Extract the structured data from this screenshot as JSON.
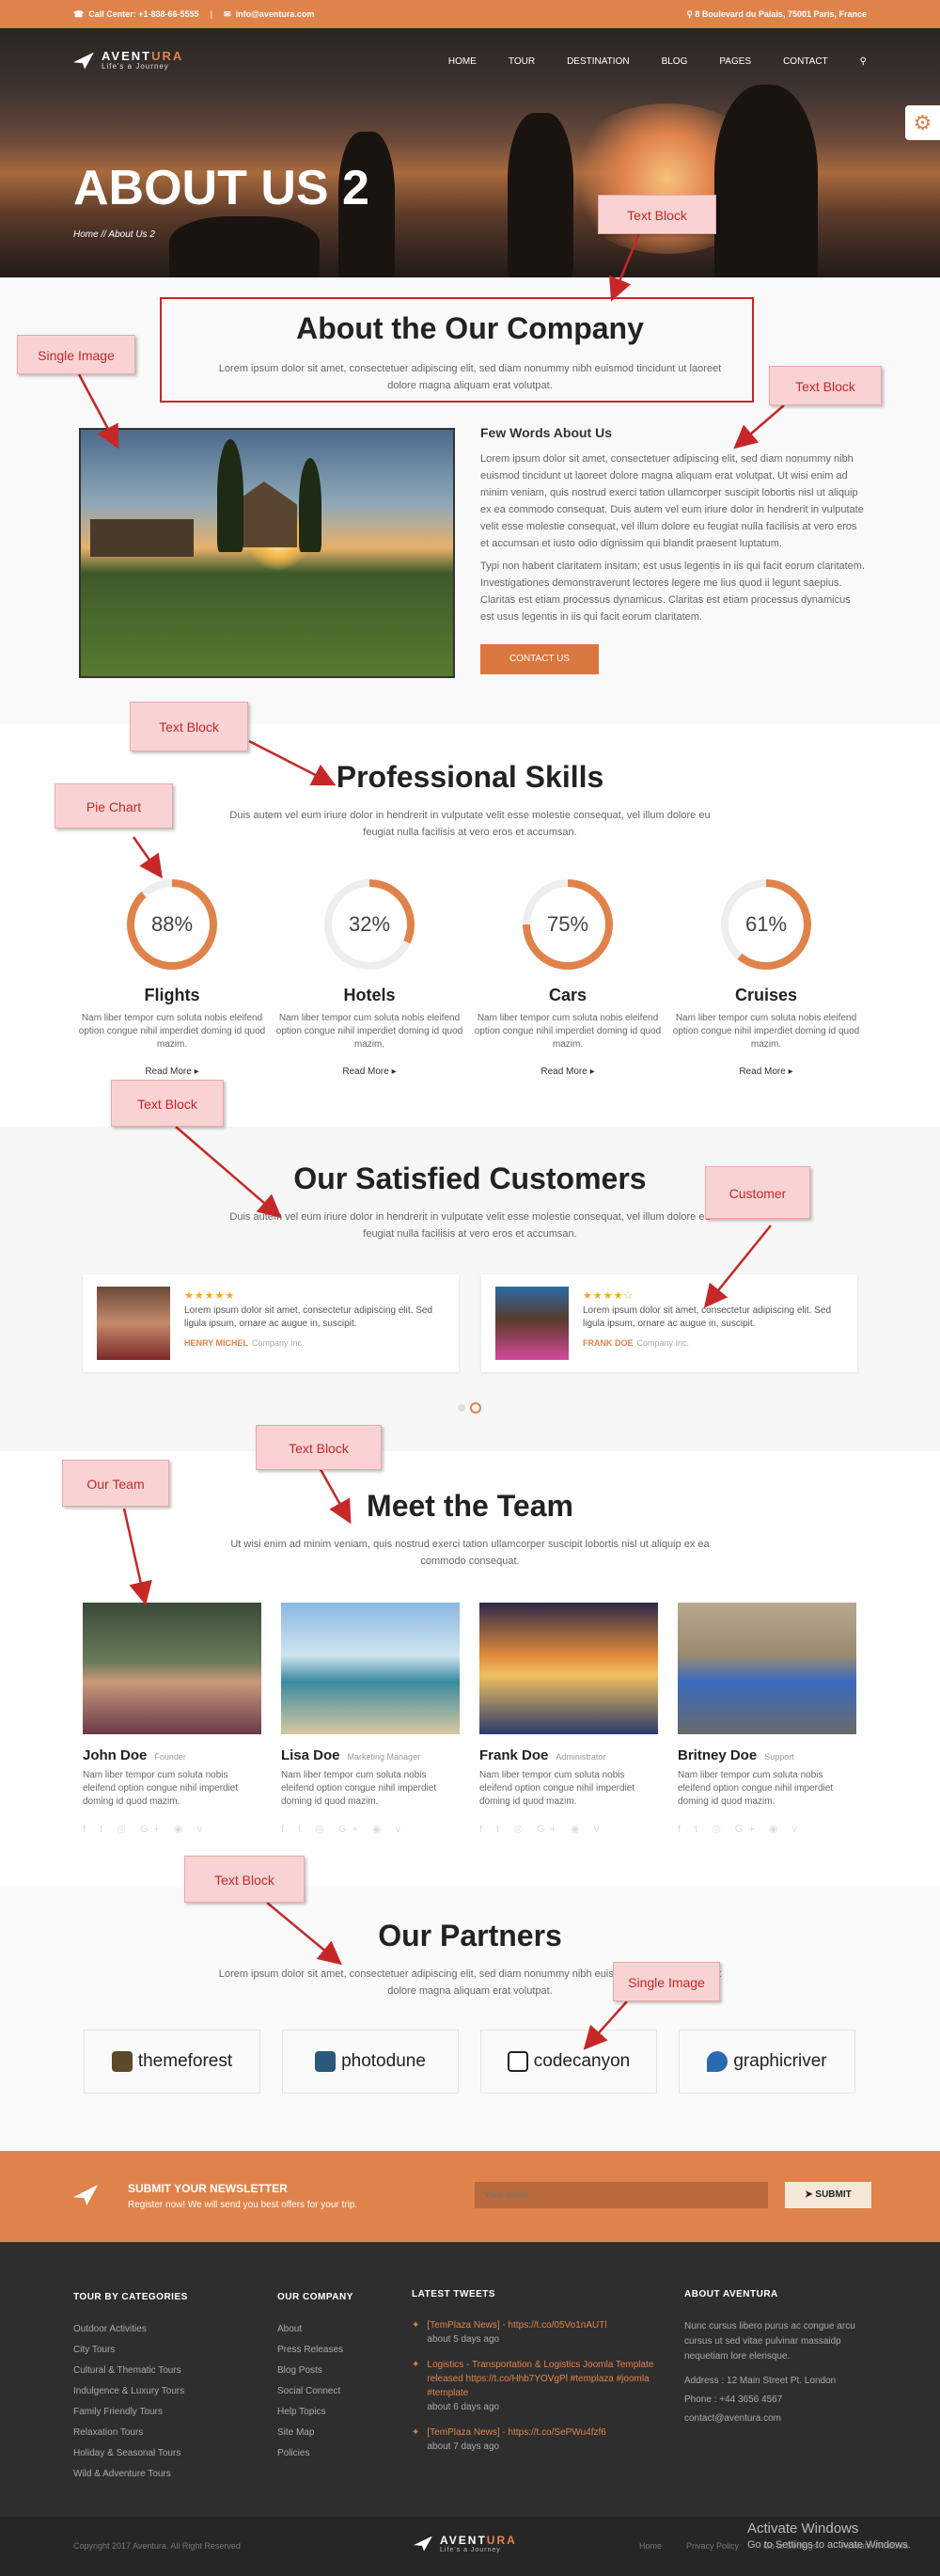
{
  "topbar": {
    "phone": "Call Center: +1-888-66-5555",
    "sep": "|",
    "email": "info@aventura.com",
    "address": "8 Boulevard du Palais, 75001 Paris, France"
  },
  "brand": {
    "name_a": "AVENT",
    "name_b": "URA",
    "tagline": "Life's a Journey"
  },
  "nav": [
    "HOME",
    "TOUR",
    "DESTINATION",
    "BLOG",
    "PAGES",
    "CONTACT"
  ],
  "hero": {
    "title": "ABOUT US 2",
    "breadcrumb": "Home  //  About Us 2"
  },
  "about": {
    "title": "About the Our Company",
    "lead": "Lorem ipsum dolor sit amet, consectetuer adipiscing elit, sed diam nonummy nibh euismod tincidunt ut laoreet dolore magna aliquam erat volutpat.",
    "subtitle": "Few Words About Us",
    "p1": "Lorem ipsum dolor sit amet, consectetuer adipiscing elit, sed diam nonummy nibh euismod tincidunt ut laoreet dolore magna aliquam erat volutpat. Ut wisi enim ad minim veniam, quis nostrud exerci tation ullamcorper suscipit lobortis nisl ut aliquip ex ea commodo consequat. Duis autem vel eum iriure dolor in hendrerit in vulputate velit esse molestie consequat, vel illum dolore eu feugiat nulla facilisis at vero eros et accumsan et iusto odio dignissim qui blandit praesent luptatum.",
    "p2": "Typi non habent claritatem insitam; est usus legentis in iis qui facit eorum claritatem. Investigationes demonstraverunt lectores legere me lius quod ii legunt saepius. Claritas est etiam processus dynamicus. Claritas est etiam processus dynamicus est usus legentis in iis qui facit eorum claritatem.",
    "button": "CONTACT US"
  },
  "skills": {
    "title": "Professional Skills",
    "lead": "Duis autem vel eum iriure dolor in hendrerit in vulputate velit esse molestie consequat, vel illum dolore eu feugiat nulla facilisis at vero eros et accumsan.",
    "items": [
      {
        "percent": "88%",
        "value": 88,
        "name": "Flights",
        "text": "Nam liber tempor cum soluta nobis eleifend option congue nihil imperdiet doming id quod mazim.",
        "link": "Read More ▸"
      },
      {
        "percent": "32%",
        "value": 32,
        "name": "Hotels",
        "text": "Nam liber tempor cum soluta nobis eleifend option congue nihil imperdiet doming id quod mazim.",
        "link": "Read More ▸"
      },
      {
        "percent": "75%",
        "value": 75,
        "name": "Cars",
        "text": "Nam liber tempor cum soluta nobis eleifend option congue nihil imperdiet doming id quod mazim.",
        "link": "Read More ▸"
      },
      {
        "percent": "61%",
        "value": 61,
        "name": "Cruises",
        "text": "Nam liber tempor cum soluta nobis eleifend option congue nihil imperdiet doming id quod mazim.",
        "link": "Read More ▸"
      }
    ]
  },
  "customers": {
    "title": "Our Satisfied Customers",
    "lead": "Duis autem vel eum iriure dolor in hendrerit in vulputate velit esse molestie consequat, vel illum dolore eu feugiat nulla facilisis at vero eros et accumsan.",
    "items": [
      {
        "stars": "★★★★★",
        "text": "Lorem ipsum dolor sit amet, consectetur adipiscing elit. Sed ligula ipsum, ornare ac augue in, suscipit.",
        "name": "HENRY MICHEL",
        "company": "Company Inc."
      },
      {
        "stars": "★★★★☆",
        "text": "Lorem ipsum dolor sit amet, consectetur adipiscing elit. Sed ligula ipsum, ornare ac augue in, suscipit.",
        "name": "FRANK DOE",
        "company": "Company Inc."
      }
    ]
  },
  "team": {
    "title": "Meet the Team",
    "lead": "Ut wisi enim ad minim veniam, quis nostrud exerci tation ullamcorper suscipit lobortis nisl ut aliquip ex ea commodo consequat.",
    "members": [
      {
        "name": "John Doe",
        "role": "Founder",
        "text": "Nam liber tempor cum soluta nobis eleifend option congue nihil imperdiet doming id quod mazim."
      },
      {
        "name": "Lisa Doe",
        "role": "Marketing Manager",
        "text": "Nam liber tempor cum soluta nobis eleifend option congue nihil imperdiet doming id quod mazim."
      },
      {
        "name": "Frank Doe",
        "role": "Administrator",
        "text": "Nam liber tempor cum soluta nobis eleifend option congue nihil imperdiet doming id quod mazim."
      },
      {
        "name": "Britney Doe",
        "role": "Support",
        "text": "Nam liber tempor cum soluta nobis eleifend option congue nihil imperdiet doming id quod mazim."
      }
    ],
    "social": "f t ◎ G+ ◉ v"
  },
  "partners": {
    "title": "Our Partners",
    "lead": "Lorem ipsum dolor sit amet, consectetuer adipiscing elit, sed diam nonummy nibh euismod tincidunt ut laoreet dolore magna aliquam erat volutpat.",
    "logos": [
      "themeforest",
      "photodune",
      "codecanyon",
      "graphicriver"
    ]
  },
  "newsletter": {
    "title": "SUBMIT YOUR NEWSLETTER",
    "text": "Register now! We will send you best offers for your trip.",
    "placeholder": "Your email",
    "button": "SUBMIT"
  },
  "footer": {
    "col1": {
      "title": "TOUR BY CATEGORIES",
      "items": [
        "Outdoor Activities",
        "City Tours",
        "Cultural & Thematic Tours",
        "Indulgence & Luxury Tours",
        "Family Friendly Tours",
        "Relaxation Tours",
        "Holiday & Seasonal Tours",
        "Wild & Adventure Tours"
      ]
    },
    "col2": {
      "title": "OUR COMPANY",
      "items": [
        "About",
        "Press Releases",
        "Blog Posts",
        "Social Connect",
        "Help Topics",
        "Site Map",
        "Policies"
      ]
    },
    "col3": {
      "title": "LATEST TWEETS",
      "tweets": [
        {
          "text": "[TemPlaza News] - https://t.co/05Vo1nAUTl",
          "time": "about 5 days ago"
        },
        {
          "text": "Logistics - Transportation & Logistics Joomla Template released https://t.co/Hhb7YOVgPl #templaza #joomla #template",
          "time": "about 6 days ago"
        },
        {
          "text": "[TemPlaza News] - https://t.co/SePWu4fzf6",
          "time": "about 7 days ago"
        }
      ]
    },
    "col4": {
      "title": "ABOUT AVENTURA",
      "text": "Nunc cursus libero purus ac congue arcu cursus ut sed vitae pulvinar massaidp nequetiam lore elerisque.",
      "address": "Address : 12 Main Street Pt. London",
      "phone": "Phone : +44 3656 4567",
      "email": "contact@aventura.com"
    }
  },
  "bottom": {
    "copyright": "Copyright 2017 Aventura. All Right Reserved",
    "links": [
      "Home",
      "Privacy Policy",
      "Go to Settings",
      "Activate Windows"
    ]
  },
  "watermark": {
    "title": "Activate Windows",
    "sub": "Go to Settings to activate Windows."
  },
  "callouts": {
    "c1": "Text Block",
    "c2": "Single Image",
    "c3": "Text Block",
    "c4": "Text Block",
    "c5": "Pie Chart",
    "c6": "Text Block",
    "c7": "Customer",
    "c8": "Our Team",
    "c9": "Text Block",
    "c10": "Text Block",
    "c11": "Single Image"
  },
  "colors": {
    "accent": "#e0834b",
    "annotation": "#c62828",
    "annotation_bg": "#f9d3d3",
    "footer": "#2e2e2e"
  }
}
